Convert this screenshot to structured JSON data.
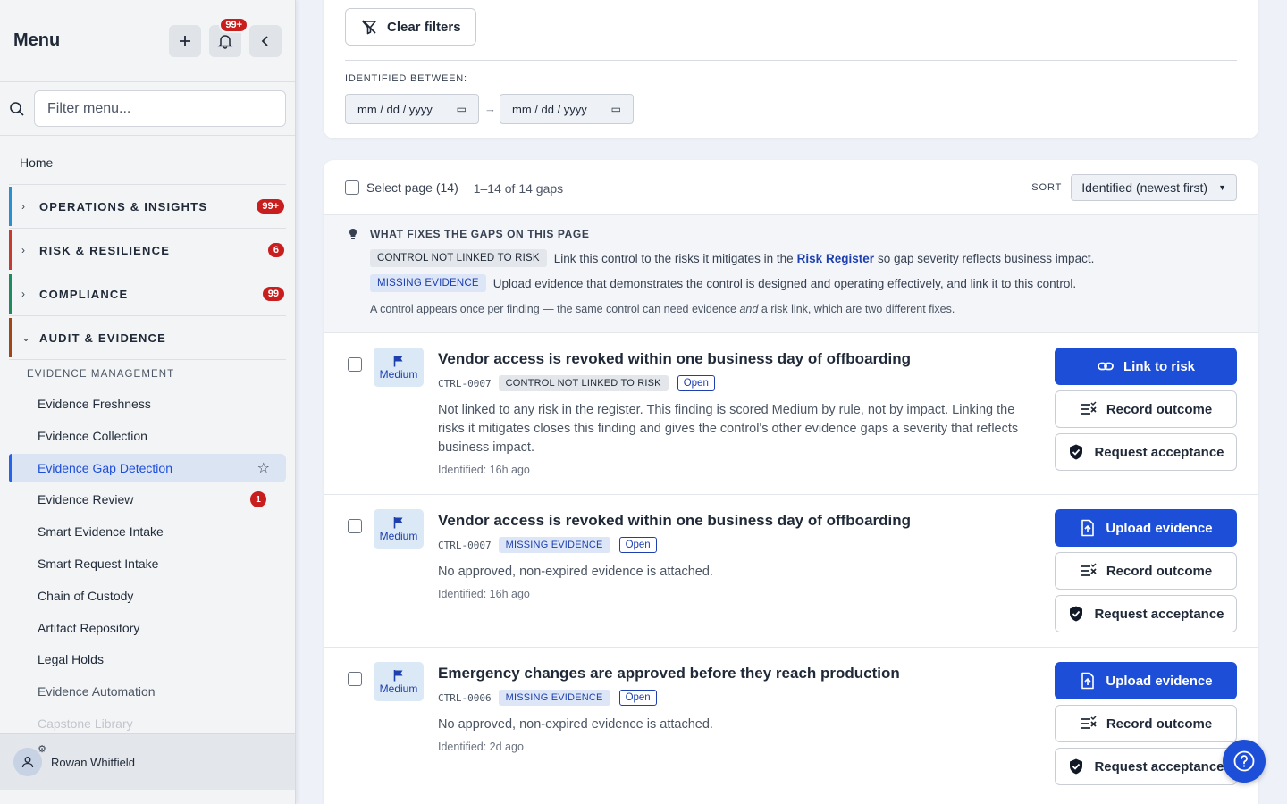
{
  "sidebar": {
    "title": "Menu",
    "notification_count": "99+",
    "search_placeholder": "Filter menu...",
    "home": "Home",
    "sections": [
      {
        "label": "OPERATIONS & INSIGHTS",
        "badge": "99+",
        "color": "#2a8fcf"
      },
      {
        "label": "RISK & RESILIENCE",
        "badge": "6",
        "color": "#c63b2f"
      },
      {
        "label": "COMPLIANCE",
        "badge": "99",
        "color": "#1f8a5e"
      },
      {
        "label": "AUDIT & EVIDENCE",
        "badge": "",
        "color": "#a0471a"
      }
    ],
    "subsection": "EVIDENCE MANAGEMENT",
    "items": [
      {
        "label": "Evidence Freshness"
      },
      {
        "label": "Evidence Collection"
      },
      {
        "label": "Evidence Gap Detection",
        "active": true
      },
      {
        "label": "Evidence Review",
        "badge": "1"
      },
      {
        "label": "Smart Evidence Intake"
      },
      {
        "label": "Smart Request Intake"
      },
      {
        "label": "Chain of Custody"
      },
      {
        "label": "Artifact Repository"
      },
      {
        "label": "Legal Holds"
      },
      {
        "label": "Evidence Automation"
      },
      {
        "label": "Capstone Library"
      }
    ],
    "user_name": "Rowan Whitfield"
  },
  "filters": {
    "clear_label": "Clear filters",
    "identified_between_label": "IDENTIFIED BETWEEN:",
    "date_from": "mm / dd / yyyy",
    "date_to": "mm / dd / yyyy",
    "arrow": "→"
  },
  "list": {
    "select_page_label": "Select page (14)",
    "range_text": "1–14 of 14 gaps",
    "sort_label": "SORT",
    "sort_value": "Identified (newest first)"
  },
  "hint": {
    "title": "WHAT FIXES THE GAPS ON THIS PAGE",
    "row1_tag": "CONTROL NOT LINKED TO RISK",
    "row1_text_a": "Link this control to the risks it mitigates in the",
    "row1_link": "Risk Register",
    "row1_text_b": "so gap severity reflects business impact.",
    "row2_tag": "MISSING EVIDENCE",
    "row2_text": "Upload evidence that demonstrates the control is designed and operating effectively, and link it to this control.",
    "note_a": "A control appears once per finding — the same control can need evidence",
    "note_em": "and",
    "note_b": "a risk link, which are two different fixes."
  },
  "gaps": [
    {
      "severity": "Medium",
      "title": "Vendor access is revoked within one business day of offboarding",
      "code": "CTRL-0007",
      "tag": "CONTROL NOT LINKED TO RISK",
      "status": "Open",
      "description": "Not linked to any risk in the register. This finding is scored Medium by rule, not by impact. Linking the risks it mitigates closes this finding and gives the control's other evidence gaps a severity that reflects business impact.",
      "identified": "Identified: 16h ago",
      "primary_action": "Link to risk",
      "record_action": "Record outcome",
      "accept_action": "Request acceptance"
    },
    {
      "severity": "Medium",
      "title": "Vendor access is revoked within one business day of offboarding",
      "code": "CTRL-0007",
      "tag": "MISSING EVIDENCE",
      "status": "Open",
      "description": "No approved, non-expired evidence is attached.",
      "identified": "Identified: 16h ago",
      "primary_action": "Upload evidence",
      "record_action": "Record outcome",
      "accept_action": "Request acceptance"
    },
    {
      "severity": "Medium",
      "title": "Emergency changes are approved before they reach production",
      "code": "CTRL-0006",
      "tag": "MISSING EVIDENCE",
      "status": "Open",
      "description": "No approved, non-expired evidence is attached.",
      "identified": "Identified: 2d ago",
      "primary_action": "Upload evidence",
      "record_action": "Record outcome",
      "accept_action": "Request acceptance"
    }
  ],
  "colors": {
    "primary": "#1d4ed8",
    "badge_red": "#c81e1e",
    "severity_bg": "#dbe8f5"
  }
}
